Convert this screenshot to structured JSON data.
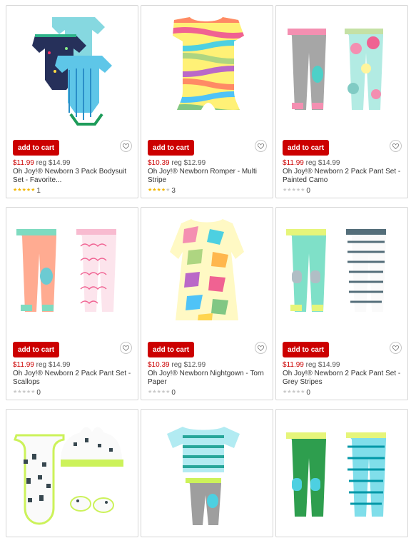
{
  "products": [
    {
      "sale": "$11.99",
      "reg": "reg $14.99",
      "title": "Oh Joy!® Newborn 3 Pack Bodysuit Set - Favorite...",
      "stars": 5,
      "count": "1",
      "image": "bodysuit-3-pack-image"
    },
    {
      "sale": "$10.39",
      "reg": "reg $12.99",
      "title": "Oh Joy!® Newborn Romper - Multi Stripe",
      "stars": 4,
      "count": "3",
      "image": "romper-multi-stripe-image"
    },
    {
      "sale": "$11.99",
      "reg": "reg $14.99",
      "title": "Oh Joy!® Newborn 2 Pack Pant Set - Painted Camo",
      "stars": 0,
      "count": "0",
      "image": "pant-set-painted-camo-image"
    },
    {
      "sale": "$11.99",
      "reg": "reg $14.99",
      "title": "Oh Joy!® Newborn 2 Pack Pant Set - Scallops",
      "stars": 0,
      "count": "0",
      "image": "pant-set-scallops-image"
    },
    {
      "sale": "$10.39",
      "reg": "reg $12.99",
      "title": "Oh Joy!® Newborn Nightgown - Torn Paper",
      "stars": 0,
      "count": "0",
      "image": "nightgown-torn-paper-image"
    },
    {
      "sale": "$11.99",
      "reg": "reg $14.99",
      "title": "Oh Joy!® Newborn 2 Pack Pant Set - Grey Stripes",
      "stars": 0,
      "count": "0",
      "image": "pant-set-grey-stripes-image"
    },
    {
      "image": "bib-hat-booties-set-image"
    },
    {
      "image": "tee-and-pant-set-image"
    },
    {
      "image": "green-pant-set-image"
    }
  ],
  "labels": {
    "add_to_cart": "add to cart"
  },
  "icons": {
    "favorite": "heart-icon",
    "rating": "star-icon"
  },
  "colors": {
    "button": "#cc0000",
    "sale_price": "#cc0000",
    "star": "#f2b600"
  }
}
